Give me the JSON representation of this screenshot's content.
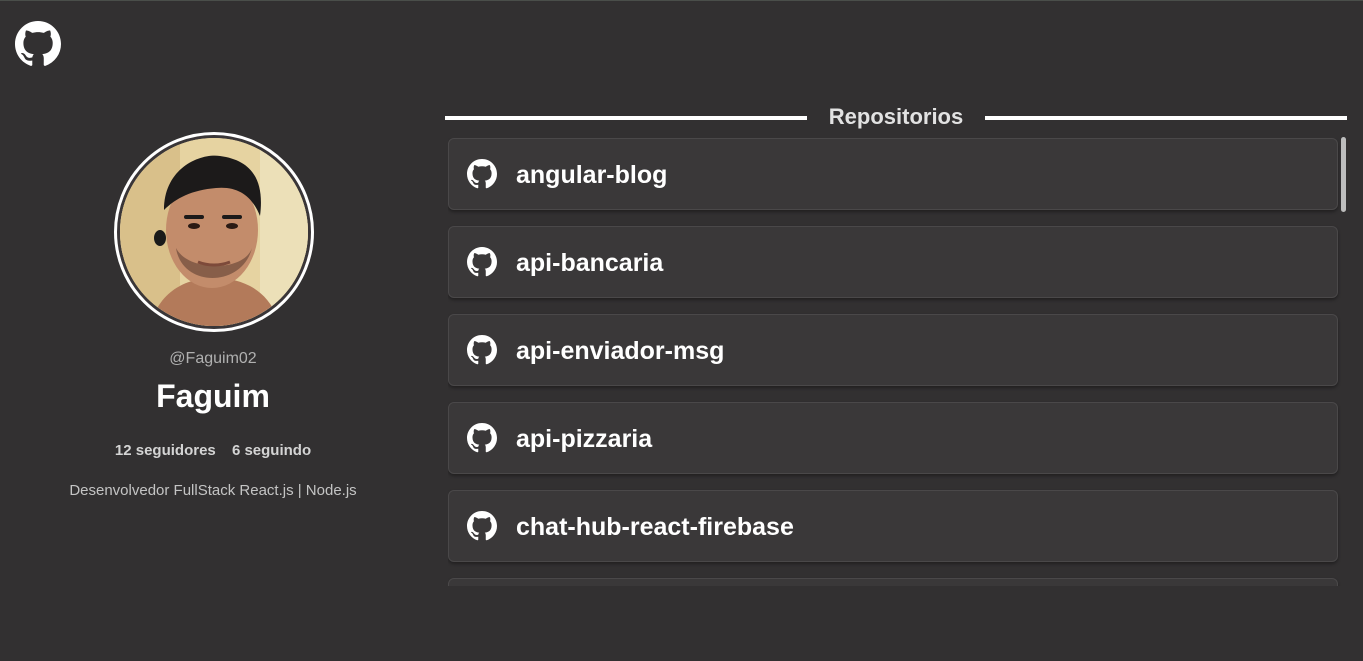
{
  "app": {
    "logo_icon": "github-icon"
  },
  "profile": {
    "avatar_icon": "avatar-photo",
    "username": "@Faguim02",
    "name": "Faguim",
    "followers": "12 seguidores",
    "following": "6 seguindo",
    "bio": "Desenvolvedor FullStack React.js | Node.js"
  },
  "repos": {
    "title": "Repositorios",
    "items": [
      {
        "name": "angular-blog",
        "icon": "github-icon"
      },
      {
        "name": "api-bancaria",
        "icon": "github-icon"
      },
      {
        "name": "api-enviador-msg",
        "icon": "github-icon"
      },
      {
        "name": "api-pizzaria",
        "icon": "github-icon"
      },
      {
        "name": "chat-hub-react-firebase",
        "icon": "github-icon"
      },
      {
        "name": "",
        "icon": "github-icon"
      }
    ]
  },
  "colors": {
    "background": "#323031",
    "card": "#3a3839",
    "text": "#ffffff",
    "muted": "#b0b0b0"
  }
}
